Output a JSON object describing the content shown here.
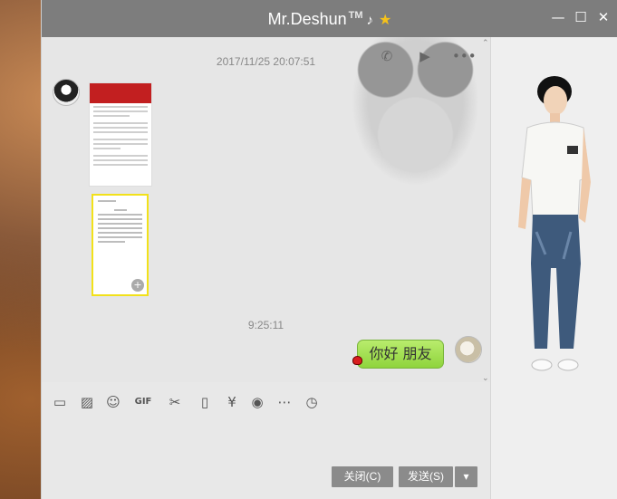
{
  "window": {
    "title": "Mr.Deshun",
    "title_badge": "TM",
    "controls": [
      "minimize-icon",
      "maximize-icon",
      "close-icon"
    ]
  },
  "call_buttons": [
    "phone-icon",
    "video-icon",
    "more-icon"
  ],
  "chat": {
    "timestamp_1": "2017/11/25 20:07:51",
    "timestamp_2": "9:25:11",
    "message_sent": "你好 朋友"
  },
  "toolbar": {
    "icons": [
      "folder-icon",
      "image-icon",
      "emoji-icon",
      "gif-icon",
      "scissors-icon",
      "shake-icon",
      "red-packet-icon",
      "music-icon",
      "more-icon",
      "history-icon"
    ],
    "gif_label": "GIF"
  },
  "actions": {
    "close_label": "关闭(C)",
    "send_label": "发送(S)"
  },
  "colors": {
    "titlebar": "#7d7d7d",
    "bubble": "#9fdf4d",
    "button": "#8b8b8b",
    "star": "#f6c21a"
  }
}
